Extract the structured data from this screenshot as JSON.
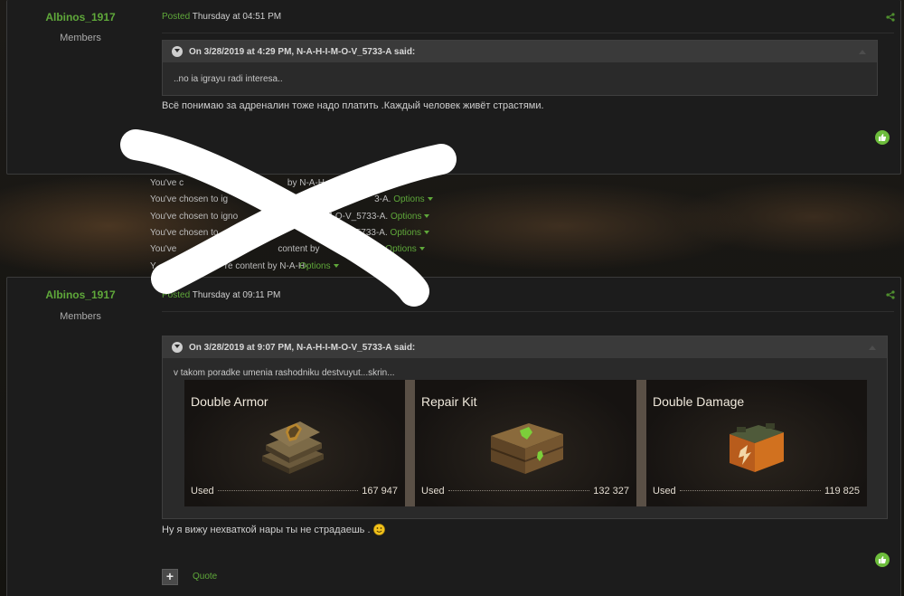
{
  "post1": {
    "author": "Albinos_1917",
    "group": "Members",
    "posted_label": "Posted",
    "posted_time": "Thursday at 04:51 PM",
    "quote": {
      "header": "On 3/28/2019 at 4:29 PM, N-A-H-I-M-O-V_5733-A said:",
      "text": "..no ia igrayu radi interesa.."
    },
    "text": "Всё понимаю за адреналин тоже надо платить .Каждый человек живёт страстями."
  },
  "ignored": [
    {
      "visible_prefix": "You've c",
      "visible_suffix": " by N-A-H-",
      "options": "Options"
    },
    {
      "visible_prefix": "You've chosen to ig",
      "visible_suffix": "3-A.",
      "options": "Options"
    },
    {
      "visible_prefix": "You've chosen to igno",
      "visible_suffix": "M-O-V_5733-A.",
      "options": "Options"
    },
    {
      "visible_prefix": "You've chosen to",
      "visible_suffix": "V_5733-A.",
      "options": "Options"
    },
    {
      "visible_prefix": "You've",
      "visible_suffix": "content by",
      "options": "Options"
    },
    {
      "visible_prefix": "Y",
      "visible_suffix": "re content by N-A-H-",
      "options": "Options"
    }
  ],
  "post2": {
    "author": "Albinos_1917",
    "group": "Members",
    "posted_label": "Posted",
    "posted_time": "Thursday at 09:11 PM",
    "quote": {
      "header": "On 3/28/2019 at 9:07 PM, N-A-H-I-M-O-V_5733-A said:",
      "text": "v takom poradke umenia rashodniku destvuyut...skrin...",
      "cards": [
        {
          "title": "Double Armor",
          "used_label": "Used",
          "used_value": "167 947",
          "icon": "double-armor-icon"
        },
        {
          "title": "Repair Kit",
          "used_label": "Used",
          "used_value": "132 327",
          "icon": "repair-kit-icon"
        },
        {
          "title": "Double Damage",
          "used_label": "Used",
          "used_value": "119 825",
          "icon": "double-damage-icon"
        }
      ]
    },
    "text": "Ну я вижу нехваткой нары ты не страдаешь .",
    "plus_label": "+",
    "quote_link": "Quote"
  },
  "colors": {
    "accent": "#5fa83a",
    "background": "#1c1c1c",
    "quote_header": "#3a3a3a",
    "like": "#6dbd3c"
  }
}
